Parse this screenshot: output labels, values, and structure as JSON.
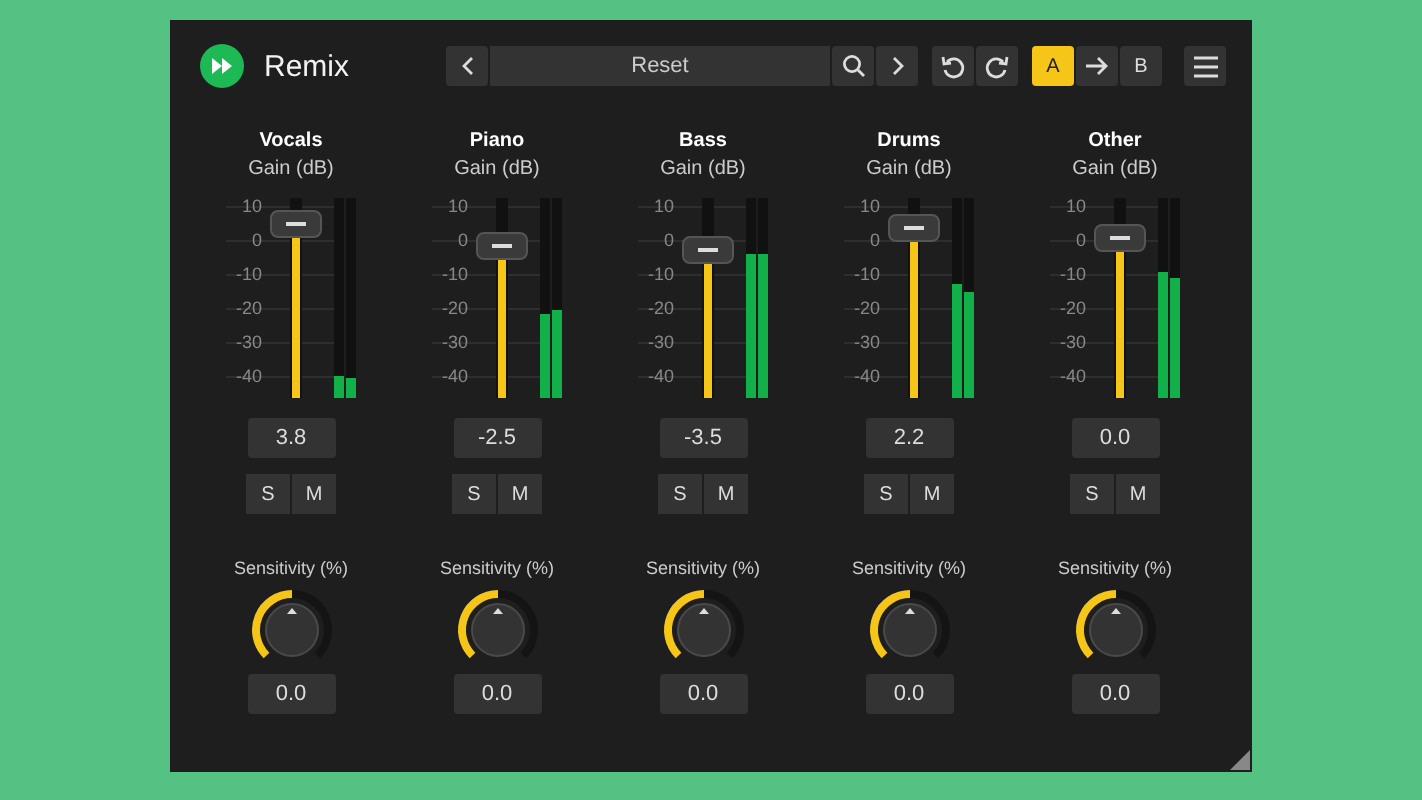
{
  "plugin": {
    "title": "Remix"
  },
  "preset": {
    "name": "Reset"
  },
  "ab": [
    {
      "label": "A",
      "selected": true
    },
    {
      "label": "B",
      "selected": false
    }
  ],
  "channels": [
    {
      "name": "Vocals",
      "gain_label": "Gain (dB)",
      "scale": [
        "10",
        "0",
        "-10",
        "-20",
        "-30",
        "-40"
      ],
      "fader": {
        "level": 0.87
      },
      "meters": [
        {
          "level": 0.11
        },
        {
          "level": 0.1
        }
      ],
      "value": "3.8",
      "solo": {
        "label": "S",
        "on": false
      },
      "mute": {
        "label": "M",
        "on": false
      },
      "sensitivity_label": "Sensitivity (%)",
      "knob": {
        "level": 0.5
      },
      "sensitivity": "0.0"
    },
    {
      "name": "Piano",
      "gain_label": "Gain (dB)",
      "scale": [
        "10",
        "0",
        "-10",
        "-20",
        "-30",
        "-40"
      ],
      "fader": {
        "level": 0.76
      },
      "meters": [
        {
          "level": 0.42
        },
        {
          "level": 0.44
        }
      ],
      "value": "-2.5",
      "solo": {
        "label": "S",
        "on": false
      },
      "mute": {
        "label": "M",
        "on": false
      },
      "sensitivity_label": "Sensitivity (%)",
      "knob": {
        "level": 0.5
      },
      "sensitivity": "0.0"
    },
    {
      "name": "Bass",
      "gain_label": "Gain (dB)",
      "scale": [
        "10",
        "0",
        "-10",
        "-20",
        "-30",
        "-40"
      ],
      "fader": {
        "level": 0.74
      },
      "meters": [
        {
          "level": 0.72
        },
        {
          "level": 0.72
        }
      ],
      "value": "-3.5",
      "solo": {
        "label": "S",
        "on": false
      },
      "mute": {
        "label": "M",
        "on": false
      },
      "sensitivity_label": "Sensitivity (%)",
      "knob": {
        "level": 0.5
      },
      "sensitivity": "0.0"
    },
    {
      "name": "Drums",
      "gain_label": "Gain (dB)",
      "scale": [
        "10",
        "0",
        "-10",
        "-20",
        "-30",
        "-40"
      ],
      "fader": {
        "level": 0.85
      },
      "meters": [
        {
          "level": 0.57
        },
        {
          "level": 0.53
        }
      ],
      "value": "2.2",
      "solo": {
        "label": "S",
        "on": false
      },
      "mute": {
        "label": "M",
        "on": false
      },
      "sensitivity_label": "Sensitivity (%)",
      "knob": {
        "level": 0.5
      },
      "sensitivity": "0.0"
    },
    {
      "name": "Other",
      "gain_label": "Gain (dB)",
      "scale": [
        "10",
        "0",
        "-10",
        "-20",
        "-30",
        "-40"
      ],
      "fader": {
        "level": 0.8
      },
      "meters": [
        {
          "level": 0.63
        },
        {
          "level": 0.6
        }
      ],
      "value": "0.0",
      "solo": {
        "label": "S",
        "on": false
      },
      "mute": {
        "label": "M",
        "on": false
      },
      "sensitivity_label": "Sensitivity (%)",
      "knob": {
        "level": 0.5
      },
      "sensitivity": "0.0"
    }
  ]
}
